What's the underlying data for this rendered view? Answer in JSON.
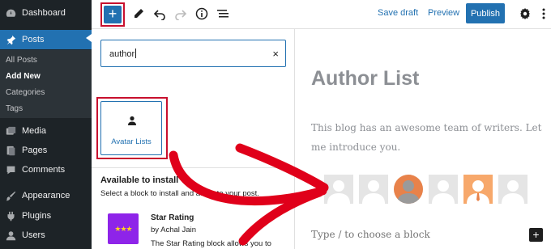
{
  "sidebar": {
    "dashboard": "Dashboard",
    "posts": "Posts",
    "submenu": [
      "All Posts",
      "Add New",
      "Categories",
      "Tags"
    ],
    "media": "Media",
    "pages": "Pages",
    "comments": "Comments",
    "appearance": "Appearance",
    "plugins": "Plugins",
    "users": "Users"
  },
  "toolbar": {
    "add_label": "+",
    "save_draft": "Save draft",
    "preview": "Preview",
    "publish": "Publish"
  },
  "inserter": {
    "search_value": "author",
    "clear_icon": "×",
    "block_label": "Avatar Lists",
    "available_title": "Available to install",
    "available_desc": "Select a block to install and add it to your post.",
    "plugin_icon_text": "★★★",
    "plugin_name": "Star Rating",
    "plugin_author": "by Achal Jain",
    "plugin_desc": "The Star Rating block allows you to"
  },
  "content": {
    "title": "Author List",
    "paragraph": "This blog has an awesome team of writers. Let me introduce you.",
    "placeholder": "Type / to choose a block",
    "add_block_label": "+"
  },
  "colors": {
    "wp_blue": "#2271b1",
    "sidebar_bg": "#1d2327",
    "highlight_red": "#c8102e",
    "arrow_red": "#e0001a"
  }
}
